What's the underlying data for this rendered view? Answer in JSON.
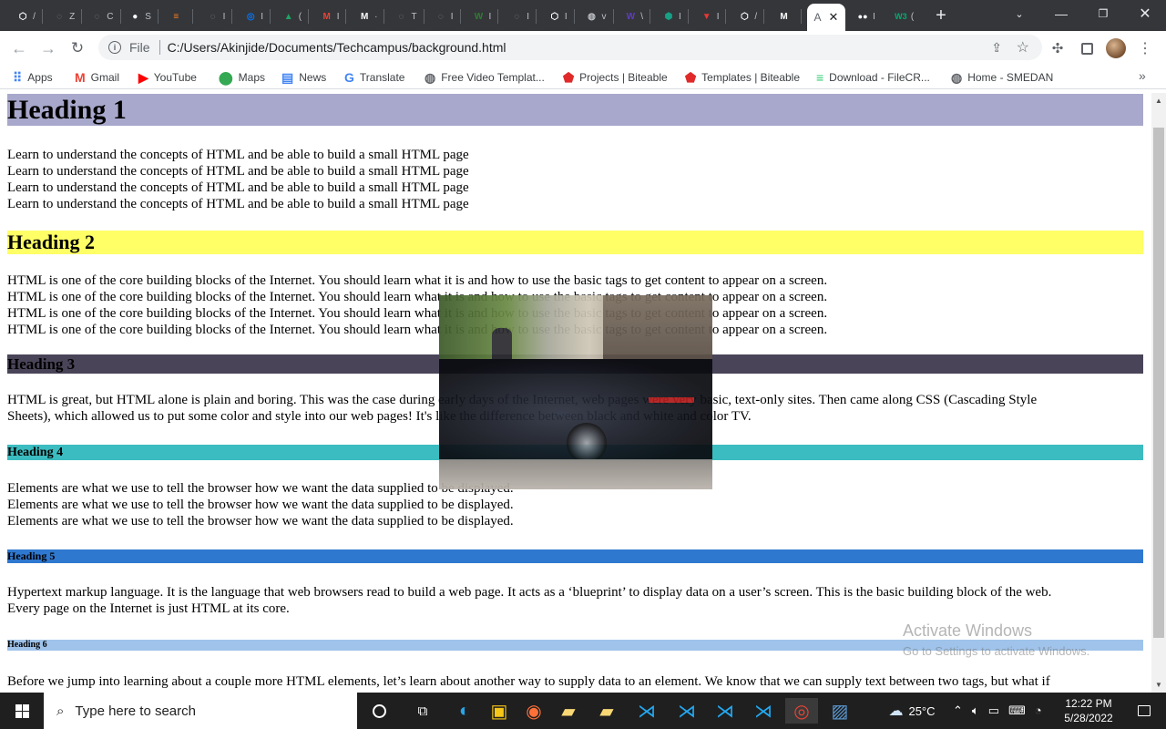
{
  "browser": {
    "tabs_visible_labels": [
      {
        "label": "/",
        "icon": "codepen-icon",
        "color": "#ffffff"
      },
      {
        "label": "Z",
        "icon": "loading-icon",
        "color": "#80868b"
      },
      {
        "label": "C",
        "icon": "loading-icon",
        "color": "#80868b"
      },
      {
        "label": "S",
        "icon": "github-icon",
        "color": "#ffffff"
      },
      {
        "label": "",
        "icon": "stackoverflow-icon",
        "color": "#f48024"
      },
      {
        "label": "I",
        "icon": "loading-icon",
        "color": "#80868b"
      },
      {
        "label": "I",
        "icon": "messenger-icon",
        "color": "#0078ff"
      },
      {
        "label": "(",
        "icon": "drive-icon",
        "color": "#1fa463"
      },
      {
        "label": "I",
        "icon": "gmail-icon",
        "color": "#ea4335"
      },
      {
        "label": "·",
        "icon": "medium-icon",
        "color": "#ffffff"
      },
      {
        "label": "T",
        "icon": "loading-icon",
        "color": "#80868b"
      },
      {
        "label": "I",
        "icon": "loading-icon",
        "color": "#80868b"
      },
      {
        "label": "I",
        "icon": "w-green-icon",
        "color": "#2e7d32"
      },
      {
        "label": "I",
        "icon": "loading-icon",
        "color": "#80868b"
      },
      {
        "label": "I",
        "icon": "codepen-icon",
        "color": "#ffffff"
      },
      {
        "label": "v",
        "icon": "globe-icon",
        "color": "#bdc1c6"
      },
      {
        "label": "\\",
        "icon": "w-purple-icon",
        "color": "#5f3dc4"
      },
      {
        "label": "I",
        "icon": "shield-icon",
        "color": "#16a085"
      },
      {
        "label": "I",
        "icon": "v-red-icon",
        "color": "#e53935"
      },
      {
        "label": "/",
        "icon": "codepen-icon",
        "color": "#ffffff"
      },
      {
        "label": "",
        "icon": "medium-icon",
        "color": "#ffffff"
      }
    ],
    "active_tab_label": "A",
    "after_tabs": [
      {
        "label": "I",
        "icon": "medium-dots-icon",
        "color": "#ffffff"
      },
      {
        "label": "(",
        "icon": "w3schools-icon",
        "color": "#04aa6d"
      }
    ],
    "new_tab_symbol": "+",
    "address_prefix": "File",
    "url": "C:/Users/Akinjide/Documents/Techcampus/background.html"
  },
  "bookmarks": [
    {
      "label": "Apps",
      "icon": "apps-grid-icon",
      "color": "#4285f4"
    },
    {
      "label": "Gmail",
      "icon": "gmail-icon",
      "color": "#ea4335"
    },
    {
      "label": "YouTube",
      "icon": "youtube-icon",
      "color": "#ff0000"
    },
    {
      "label": "Maps",
      "icon": "maps-pin-icon",
      "color": "#34a853"
    },
    {
      "label": "News",
      "icon": "news-icon",
      "color": "#4285f4"
    },
    {
      "label": "Translate",
      "icon": "translate-icon",
      "color": "#4285f4"
    },
    {
      "label": "Free Video Templat...",
      "icon": "globe-icon",
      "color": "#5f6368"
    },
    {
      "label": "Projects | Biteable",
      "icon": "biteable-icon",
      "color": "#e02a2a"
    },
    {
      "label": "Templates | Biteable",
      "icon": "biteable-icon",
      "color": "#e02a2a"
    },
    {
      "label": "Download - FileCR...",
      "icon": "filecr-icon",
      "color": "#2ecc71"
    },
    {
      "label": "Home - SMEDAN",
      "icon": "globe-icon",
      "color": "#5f6368"
    }
  ],
  "bookmarks_overflow": "»",
  "page": {
    "h1": {
      "text": "Heading 1",
      "bg": "#a8a8cc"
    },
    "p1": [
      "Learn to understand the concepts of HTML and be able to build a small HTML page",
      "Learn to understand the concepts of HTML and be able to build a small HTML page",
      "Learn to understand the concepts of HTML and be able to build a small HTML page",
      "Learn to understand the concepts of HTML and be able to build a small HTML page"
    ],
    "h2": {
      "text": "Heading 2",
      "bg": "#ffff66"
    },
    "p2": [
      "HTML is one of the core building blocks of the Internet. You should learn what it is and how to use the basic tags to get content to appear on a screen.",
      "HTML is one of the core building blocks of the Internet. You should learn what it is and how to use the basic tags to get content to appear on a screen.",
      "HTML is one of the core building blocks of the Internet. You should learn what it is and how to use the basic tags to get content to appear on a screen.",
      "HTML is one of the core building blocks of the Internet. You should learn what it is and how to use the basic tags to get content to appear on a screen."
    ],
    "h3": {
      "text": "Heading 3",
      "bg": "#4a4458"
    },
    "p3": [
      "HTML is great, but HTML alone is plain and boring. This was the case during early days of the Internet, web pages were very basic, text-only sites. Then came along CSS (Cascading Style",
      "Sheets), which allowed us to put some color and style into our web pages! It's like the difference between black and white and color TV."
    ],
    "h4": {
      "text": "Heading 4",
      "bg": "#3bbcc0"
    },
    "p4": [
      "Elements are what we use to tell the browser how we want the data supplied to be displayed.",
      "Elements are what we use to tell the browser how we want the data supplied to be displayed.",
      "Elements are what we use to tell the browser how we want the data supplied to be displayed."
    ],
    "h5": {
      "text": "Heading 5",
      "bg": "#2f78d0"
    },
    "p5": [
      "Hypertext markup language. It is the language that web browsers read to build a web page. It acts as a ‘blueprint’ to display data on a user’s screen. This is the basic building block of the web.",
      "Every page on the Internet is just HTML at its core."
    ],
    "h6": {
      "text": "Heading 6",
      "bg": "#9fc3ea"
    },
    "p6": [
      "Before we jump into learning about a couple more HTML elements, let’s learn about another way to supply data to an element. We know that we can supply text between two tags, but what if"
    ]
  },
  "watermark": {
    "line1": "Activate Windows",
    "line2": "Go to Settings to activate Windows."
  },
  "taskbar": {
    "search_placeholder": "Type here to search",
    "weather": "25°C",
    "time": "12:22 PM",
    "date": "5/28/2022"
  }
}
